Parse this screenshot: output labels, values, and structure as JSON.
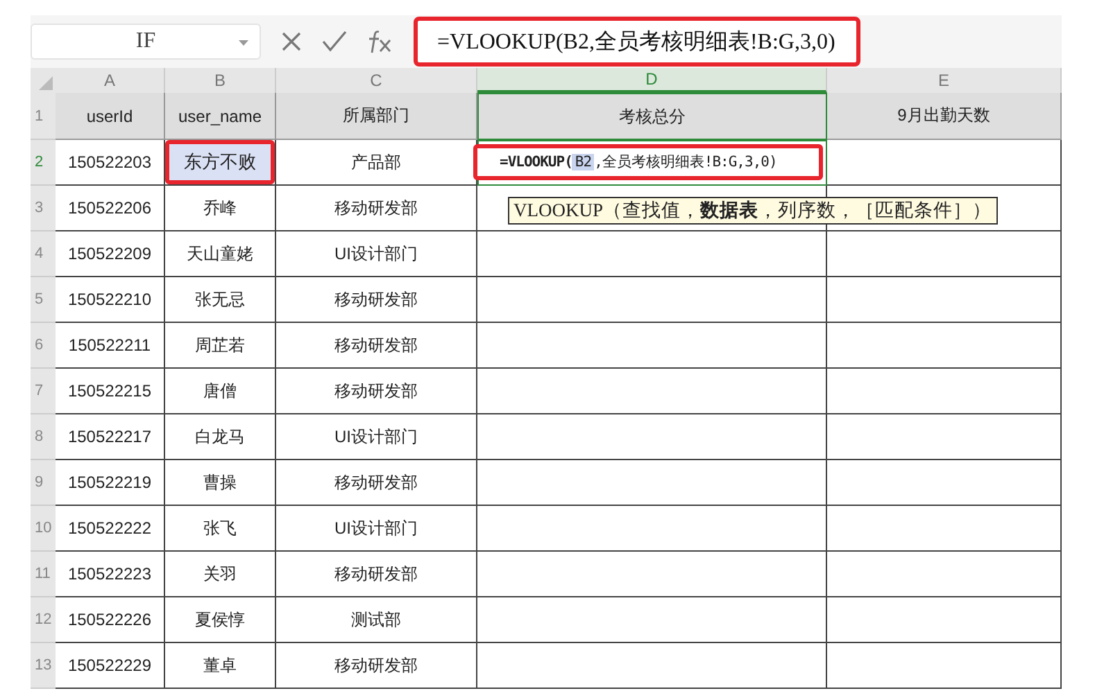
{
  "name_box": {
    "value": "IF"
  },
  "formula_bar": {
    "value": "=VLOOKUP(B2,全员考核明细表!B:G,3,0)",
    "annotated": true
  },
  "columns": [
    {
      "letter": "A",
      "selected": false
    },
    {
      "letter": "B",
      "selected": false
    },
    {
      "letter": "C",
      "selected": false
    },
    {
      "letter": "D",
      "selected": true
    },
    {
      "letter": "E",
      "selected": false
    }
  ],
  "header_row": {
    "number": "1",
    "cells": [
      "userId",
      "user_name",
      "所属部门",
      "考核总分",
      "9月出勤天数"
    ]
  },
  "rows": [
    {
      "number": "2",
      "id": "150522203",
      "name": "东方不败",
      "dept": "产品部",
      "active": true,
      "name_referenced": true
    },
    {
      "number": "3",
      "id": "150522206",
      "name": "乔峰",
      "dept": "移动研发部",
      "active": false,
      "name_referenced": false
    },
    {
      "number": "4",
      "id": "150522209",
      "name": "天山童姥",
      "dept": "UI设计部门",
      "active": false,
      "name_referenced": false
    },
    {
      "number": "5",
      "id": "150522210",
      "name": "张无忌",
      "dept": "移动研发部",
      "active": false,
      "name_referenced": false
    },
    {
      "number": "6",
      "id": "150522211",
      "name": "周芷若",
      "dept": "移动研发部",
      "active": false,
      "name_referenced": false
    },
    {
      "number": "7",
      "id": "150522215",
      "name": "唐僧",
      "dept": "移动研发部",
      "active": false,
      "name_referenced": false
    },
    {
      "number": "8",
      "id": "150522217",
      "name": "白龙马",
      "dept": "UI设计部门",
      "active": false,
      "name_referenced": false
    },
    {
      "number": "9",
      "id": "150522219",
      "name": "曹操",
      "dept": "移动研发部",
      "active": false,
      "name_referenced": false
    },
    {
      "number": "10",
      "id": "150522222",
      "name": "张飞",
      "dept": "UI设计部门",
      "active": false,
      "name_referenced": false
    },
    {
      "number": "11",
      "id": "150522223",
      "name": "关羽",
      "dept": "移动研发部",
      "active": false,
      "name_referenced": false
    },
    {
      "number": "12",
      "id": "150522226",
      "name": "夏侯惇",
      "dept": "测试部",
      "active": false,
      "name_referenced": false
    },
    {
      "number": "13",
      "id": "150522229",
      "name": "董卓",
      "dept": "移动研发部",
      "active": false,
      "name_referenced": false
    }
  ],
  "cell_editor": {
    "prefix": "=VLOOKUP(",
    "reference": "B2",
    "rest": ",全员考核明细表!B:G,3,0)",
    "annotated": true
  },
  "tooltip": {
    "text": "VLOOKUP（查找值，**数据表**，列序数，［匹配条件］）"
  }
}
